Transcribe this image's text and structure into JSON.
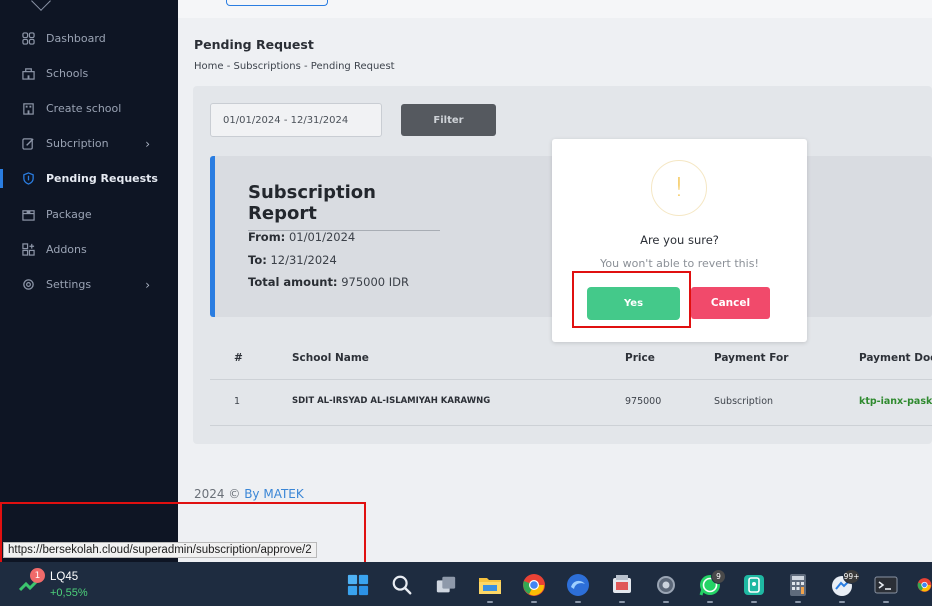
{
  "sidebar": {
    "items": [
      {
        "label": "Dashboard",
        "icon": "grid-icon"
      },
      {
        "label": "Schools",
        "icon": "school-icon"
      },
      {
        "label": "Create school",
        "icon": "building-icon"
      },
      {
        "label": "Subcription",
        "icon": "edit-icon",
        "has_submenu": true
      },
      {
        "label": "Pending Requests",
        "icon": "shield-icon",
        "active": true
      },
      {
        "label": "Package",
        "icon": "box-icon"
      },
      {
        "label": "Addons",
        "icon": "addons-icon"
      },
      {
        "label": "Settings",
        "icon": "gear-icon",
        "has_submenu": true
      }
    ],
    "chevron": "›"
  },
  "page": {
    "title": "Pending Request",
    "breadcrumb": "Home - Subscriptions - Pending Request"
  },
  "filter": {
    "date_range": "01/01/2024 - 12/31/2024",
    "button_label": "Filter"
  },
  "report": {
    "title": "Subscription Report",
    "from_label": "From:",
    "from_value": "01/01/2024",
    "to_label": "To:",
    "to_value": "12/31/2024",
    "total_label": "Total amount:",
    "total_value": "975000 IDR"
  },
  "table": {
    "headers": [
      "#",
      "School Name",
      "Price",
      "Payment For",
      "Payment Doc"
    ],
    "rows": [
      [
        "1",
        "SDIT AL-IRSYAD AL-ISLAMIYAH KARAWNG",
        "975000",
        "Subscription",
        "ktp-ianx-pask"
      ]
    ]
  },
  "footer": {
    "year": "2024 ©",
    "by": "By MATEK"
  },
  "modal": {
    "icon_glyph": "!",
    "title": "Are you sure?",
    "text": "You won't able to revert this!",
    "yes_label": "Yes",
    "cancel_label": "Cancel"
  },
  "status_bar": {
    "url": "https://bersekolah.cloud/superadmin/subscription/approve/2"
  },
  "taskbar": {
    "stock_badge": "1",
    "stock_name": "LQ45",
    "stock_change": "+0,55%",
    "whatsapp_badge": "9",
    "app_badge": "99+"
  },
  "colors": {
    "accent": "#2a7de1",
    "yes": "#44c98a",
    "cancel": "#f14a6b",
    "highlight": "#e01010",
    "payment_doc": "#2f8a2f"
  }
}
